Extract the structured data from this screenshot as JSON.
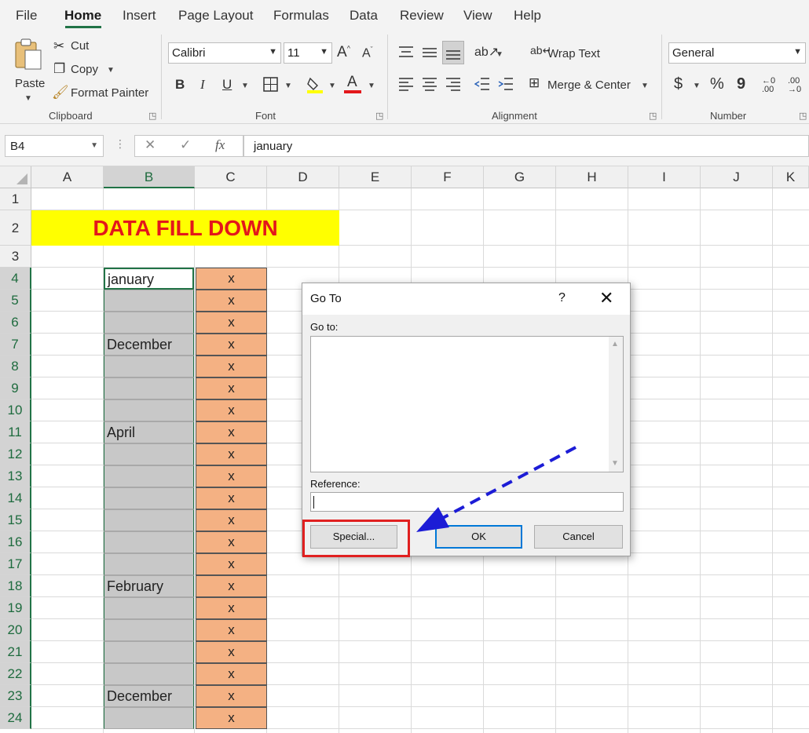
{
  "menu": {
    "tabs": [
      "File",
      "Home",
      "Insert",
      "Page Layout",
      "Formulas",
      "Data",
      "Review",
      "View",
      "Help"
    ],
    "active_tab": "Home"
  },
  "ribbon": {
    "clipboard": {
      "paste_label": "Paste",
      "cut_label": "Cut",
      "copy_label": "Copy",
      "format_painter_label": "Format Painter",
      "group_label": "Clipboard"
    },
    "font": {
      "font_name": "Calibri",
      "font_size": "11",
      "bold": "B",
      "italic": "I",
      "underline": "U",
      "group_label": "Font"
    },
    "alignment": {
      "wrap_text_label": "Wrap Text",
      "merge_center_label": "Merge & Center",
      "group_label": "Alignment"
    },
    "number": {
      "format": "General",
      "currency": "$",
      "percent": "%",
      "comma": "9",
      "group_label": "Number"
    }
  },
  "formula_bar": {
    "name_box": "B4",
    "fx_label": "fx",
    "content": "january"
  },
  "sheet": {
    "columns": [
      "A",
      "B",
      "C",
      "D",
      "E",
      "F",
      "G",
      "H",
      "I",
      "J",
      "K"
    ],
    "rows": [
      "1",
      "2",
      "3",
      "4",
      "5",
      "6",
      "7",
      "8",
      "9",
      "10",
      "11",
      "12",
      "13",
      "14",
      "15",
      "16",
      "17",
      "18",
      "19",
      "20",
      "21",
      "22",
      "23",
      "24"
    ],
    "title": "DATA FILL DOWN",
    "b_values": [
      "january",
      "",
      "",
      "December",
      "",
      "",
      "",
      "April",
      "",
      "",
      "",
      "",
      "",
      "",
      "February",
      "",
      "",
      "",
      "",
      "December",
      ""
    ],
    "c_values": [
      "x",
      "x",
      "x",
      "x",
      "x",
      "x",
      "x",
      "x",
      "x",
      "x",
      "x",
      "x",
      "x",
      "x",
      "x",
      "x",
      "x",
      "x",
      "x",
      "x",
      "x"
    ]
  },
  "dialog": {
    "title": "Go To",
    "help": "?",
    "close": "✕",
    "goto_label": "Go to:",
    "reference_label": "Reference:",
    "reference_value": "",
    "special_button": "Special...",
    "ok_button": "OK",
    "cancel_button": "Cancel"
  },
  "colors": {
    "accent": "#217346",
    "title_fill": "#ffff00",
    "title_text": "#e3171b",
    "b_fill": "#c8c8c8",
    "c_fill": "#f4b183",
    "highlight": "#e02020",
    "arrow": "#1c1cd6"
  }
}
